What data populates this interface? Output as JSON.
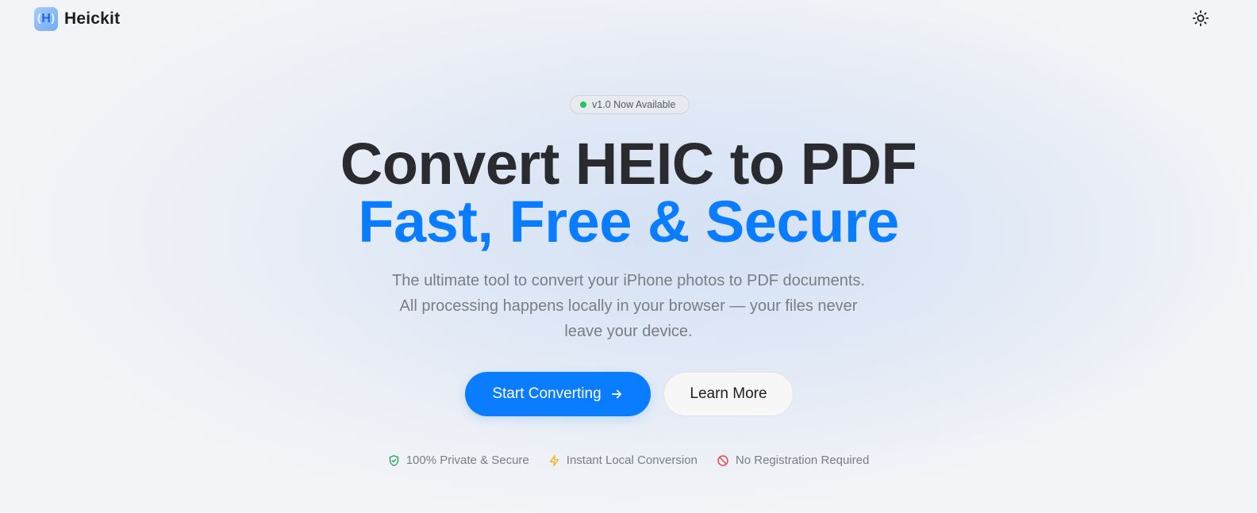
{
  "header": {
    "brand_name": "Heickit",
    "logo_letter": "H",
    "theme_toggle_icon": "sun-icon"
  },
  "hero": {
    "badge_text": "v1.0 Now Available",
    "headline_line1": "Convert HEIC to PDF",
    "headline_line2": "Fast, Free & Secure",
    "subtitle_lines": [
      "The ultimate tool to convert your iPhone photos to PDF documents.",
      "All processing happens locally in your browser — your files never",
      "leave your device."
    ],
    "primary_button_label": "Start Converting",
    "secondary_button_label": "Learn More"
  },
  "features": [
    {
      "label": "100% Private & Secure",
      "icon": "shield-check-icon",
      "color": "#22a55a"
    },
    {
      "label": "Instant Local Conversion",
      "icon": "lightning-icon",
      "color": "#f2b21b"
    },
    {
      "label": "No Registration Required",
      "icon": "prohibited-icon",
      "color": "#e5484d"
    }
  ],
  "colors": {
    "accent": "#0a7cff",
    "badge_dot": "#22c55e"
  }
}
